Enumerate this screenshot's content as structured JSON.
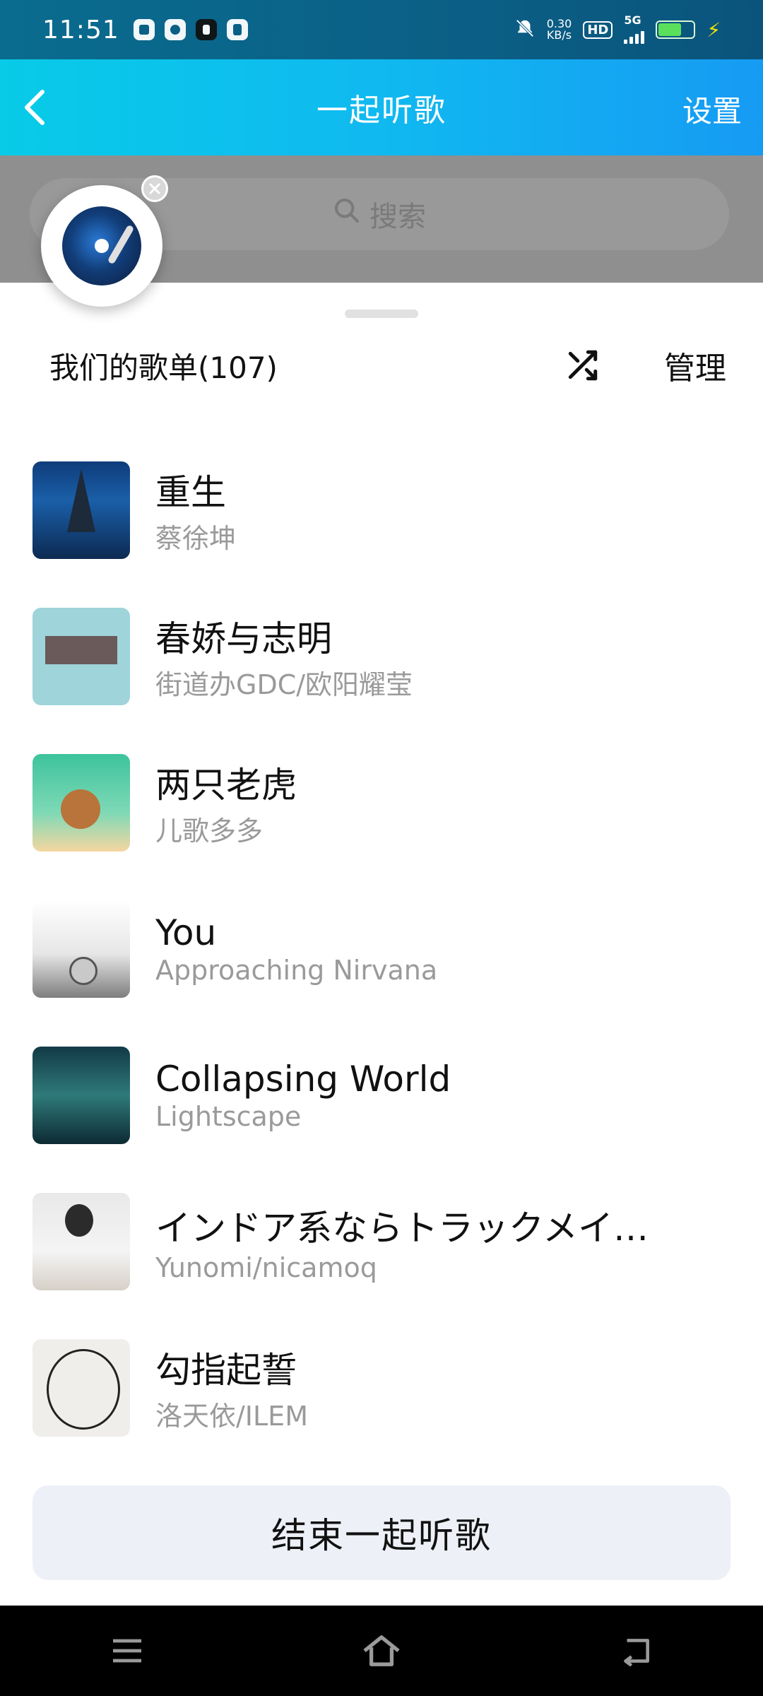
{
  "status_bar": {
    "time": "11:51",
    "net_speed_value": "0.30",
    "net_speed_unit": "KB/s",
    "hd": "HD",
    "network": "5G",
    "icons": [
      "video-app-icon",
      "speed-icon",
      "tiktok-icon",
      "document-icon",
      "mute-bell-icon",
      "signal-icon",
      "battery-icon",
      "charging-icon"
    ]
  },
  "app_bar": {
    "title": "一起听歌",
    "settings_label": "设置"
  },
  "search": {
    "placeholder": "搜索"
  },
  "sheet": {
    "playlist_title": "我们的歌单(107)",
    "manage_label": "管理"
  },
  "songs": [
    {
      "title": "重生",
      "artist": "蔡徐坤"
    },
    {
      "title": "春娇与志明",
      "artist": "街道办GDC/欧阳耀莹"
    },
    {
      "title": "两只老虎",
      "artist": "儿歌多多"
    },
    {
      "title": "You",
      "artist": "Approaching Nirvana"
    },
    {
      "title": "Collapsing World",
      "artist": "Lightscape"
    },
    {
      "title": "インドア系ならトラックメイカー",
      "artist": "Yunomi/nicamoq"
    },
    {
      "title": "勾指起誓",
      "artist": "洛天依/ILEM"
    }
  ],
  "footer": {
    "end_button_label": "结束一起听歌"
  },
  "colors": {
    "app_bar_start": "#08cbe8",
    "app_bar_end": "#169bf3",
    "status_bar": "#0b5f86",
    "button_bg": "#edf0f6"
  }
}
